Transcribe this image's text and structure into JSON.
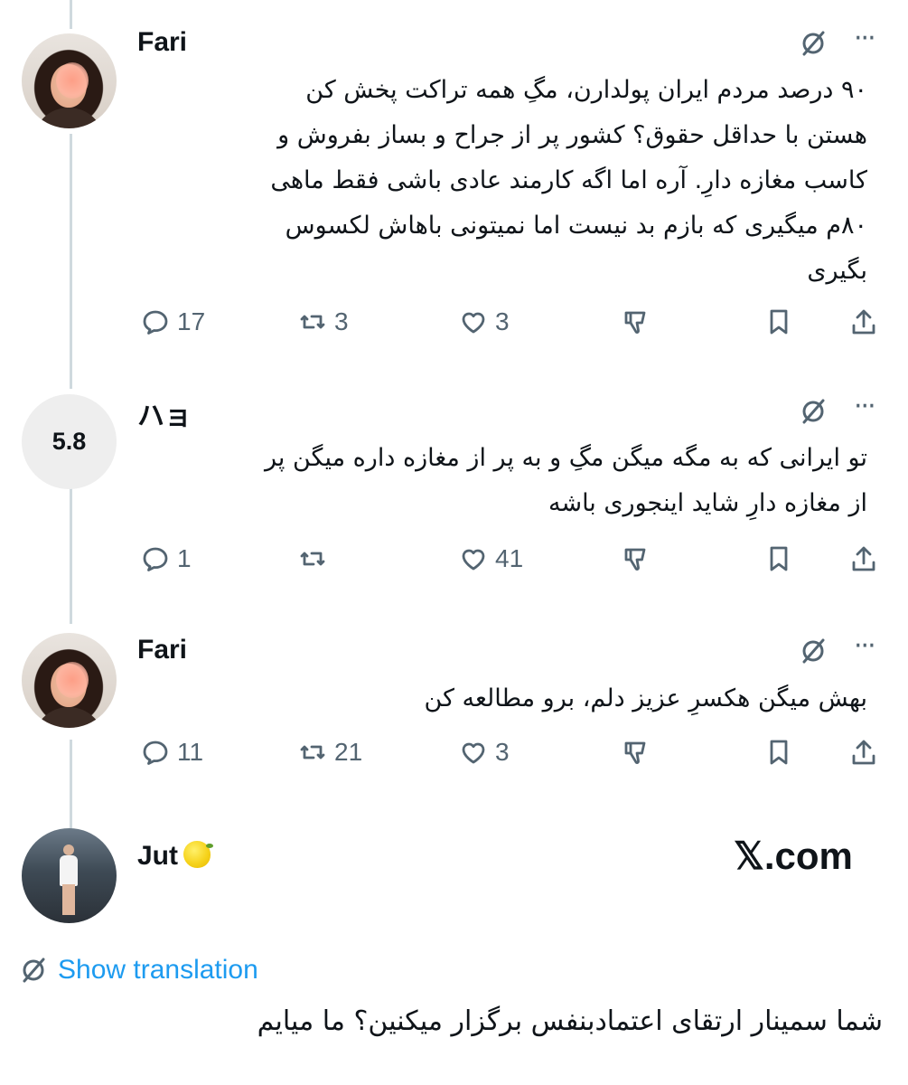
{
  "tweets": [
    {
      "author": "Fari",
      "text_lines": [
        "۹۰ درصد مردم ایران پولدارن، مگِ همه تراکت پخش کن",
        "هستن با حداقل حقوق؟ کشور پر از جراح و بساز بفروش و",
        "کاسب مغازه دارِ. آره اما اگه کارمند عادی باشی فقط ماهی",
        "۸۰م میگیری که بازم بد نیست اما نمیتونی باهاش لکسوس",
        "بگیری"
      ],
      "replies": "17",
      "reposts": "3",
      "likes": "3"
    },
    {
      "author": "ハョ",
      "avatar_text": "5.8",
      "text_lines": [
        "تو ایرانی که به مگه میگن مگِ و به پر از مغازه داره میگن پر",
        "از مغازه دارِ شاید اینجوری باشه"
      ],
      "replies": "1",
      "reposts": "",
      "likes": "41"
    },
    {
      "author": "Fari",
      "text_lines": [
        "بهش میگن هکسرِ عزیز دلم، برو مطالعه کن"
      ],
      "replies": "11",
      "reposts": "21",
      "likes": "3"
    }
  ],
  "main_tweet": {
    "author": "Jut",
    "emoji_icon": "lemon-emoji",
    "watermark": "𝕏.com",
    "show_translation": "Show translation",
    "text": "شما سمینار ارتقای اعتمادبنفس برگزار میکنین؟ ما میایم"
  },
  "colors": {
    "text": "#0f1419",
    "muted": "#536471",
    "link": "#1d9bf0",
    "thread_line": "#cfd9de"
  }
}
